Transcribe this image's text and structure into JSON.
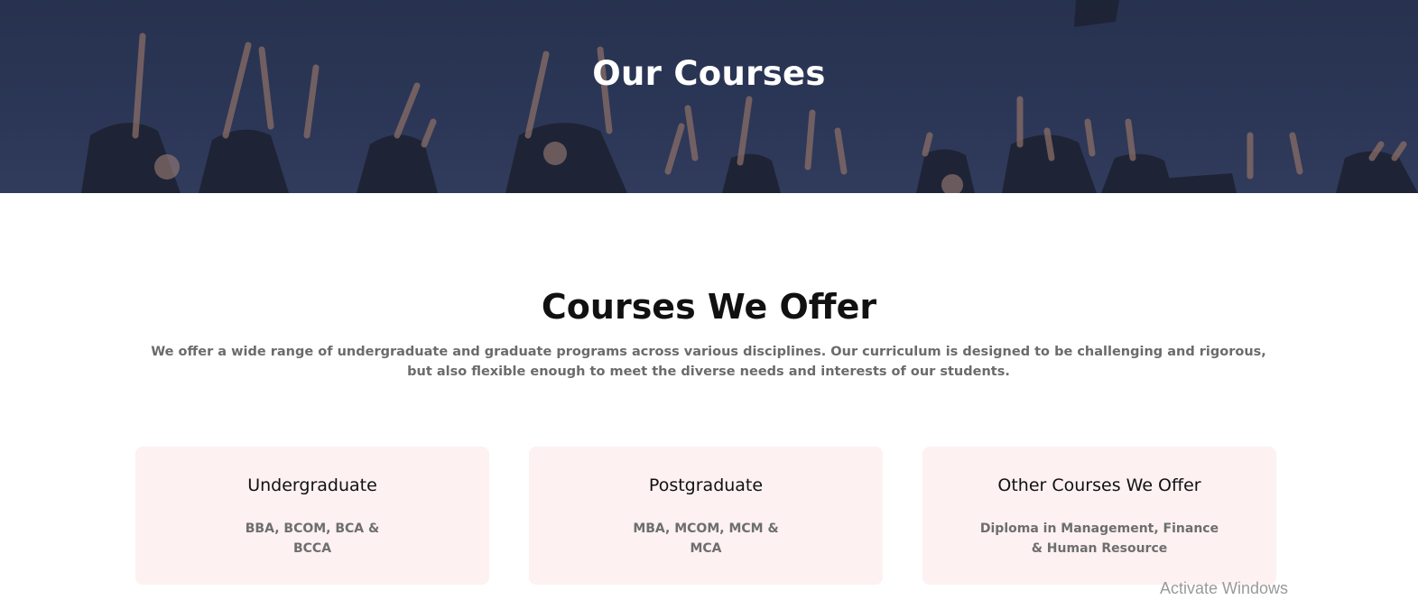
{
  "hero": {
    "title": "Our Courses"
  },
  "section": {
    "title": "Courses We Offer",
    "description": "We offer a wide range of undergraduate and graduate programs across various disciplines. Our curriculum is designed to be challenging and rigorous, but also flexible enough to meet the diverse needs and interests of our students."
  },
  "cards": [
    {
      "title": "Undergraduate",
      "description": "BBA, BCOM, BCA & BCCA"
    },
    {
      "title": "Postgraduate",
      "description": "MBA, MCOM, MCM & MCA"
    },
    {
      "title": "Other Courses We Offer",
      "description": "Diploma in Management, Finance & Human Resource"
    }
  ],
  "system": {
    "watermark": "Activate Windows"
  },
  "colors": {
    "hero_overlay": "#2b3656",
    "card_background": "#fdf1f1",
    "heading_text": "#111111",
    "body_text": "#6b6b6b"
  }
}
